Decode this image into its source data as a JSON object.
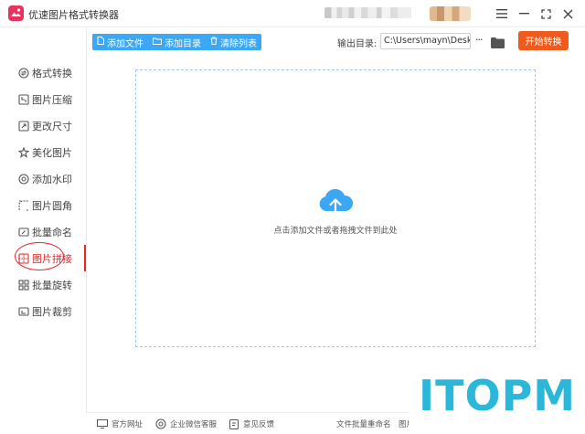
{
  "app": {
    "title": "优速图片格式转换器",
    "window_controls": [
      "menu-icon",
      "minimize-icon",
      "maximize-icon",
      "close-icon"
    ]
  },
  "sidebar": {
    "items": [
      {
        "label": "格式转换",
        "icon": "convert-icon"
      },
      {
        "label": "图片压缩",
        "icon": "compress-icon"
      },
      {
        "label": "更改尺寸",
        "icon": "resize-icon"
      },
      {
        "label": "美化图片",
        "icon": "beautify-icon"
      },
      {
        "label": "添加水印",
        "icon": "watermark-icon"
      },
      {
        "label": "图片圆角",
        "icon": "rounded-corner-icon"
      },
      {
        "label": "批量命名",
        "icon": "rename-icon"
      },
      {
        "label": "图片拼接",
        "icon": "stitch-icon",
        "active": true
      },
      {
        "label": "批量旋转",
        "icon": "rotate-icon"
      },
      {
        "label": "图片裁剪",
        "icon": "crop-icon"
      }
    ]
  },
  "toolbar": {
    "add_file": "添加文件",
    "add_dir": "添加目录",
    "clear_list": "清除列表",
    "output_label": "输出目录:",
    "output_path": "C:\\Users\\mayn\\Desktop",
    "more": "···",
    "start": "开始转换"
  },
  "dropzone": {
    "hint": "点击添加文件或者拖拽文件到此处"
  },
  "footer": {
    "website": "官方网址",
    "wechat": "企业微信客服",
    "feedback": "意见反馈",
    "batch_rename": "文件批量重命名",
    "picture": "图片"
  },
  "watermark": {
    "text": "ITOPM"
  },
  "colors": {
    "accent_blue": "#3ba7f5",
    "start_orange": "#f05a1c",
    "active_red": "#e02b2b",
    "logo_pink": "#e8335c",
    "watermark_cyan": "#2bb7d9"
  }
}
